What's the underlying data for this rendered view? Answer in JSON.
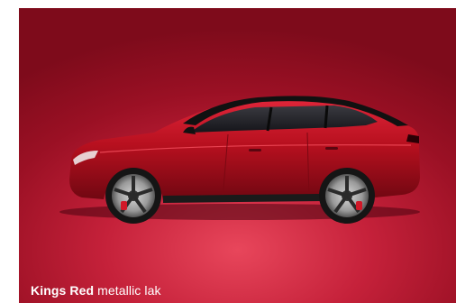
{
  "caption": {
    "color_name": "Kings Red",
    "finish": "metallic lak"
  },
  "colors": {
    "background_dark": "#7e0b1b",
    "background_light": "#e8465b",
    "car_body": "#b8101f",
    "roof": "#111111"
  },
  "image": {
    "subject": "car-side-view"
  }
}
